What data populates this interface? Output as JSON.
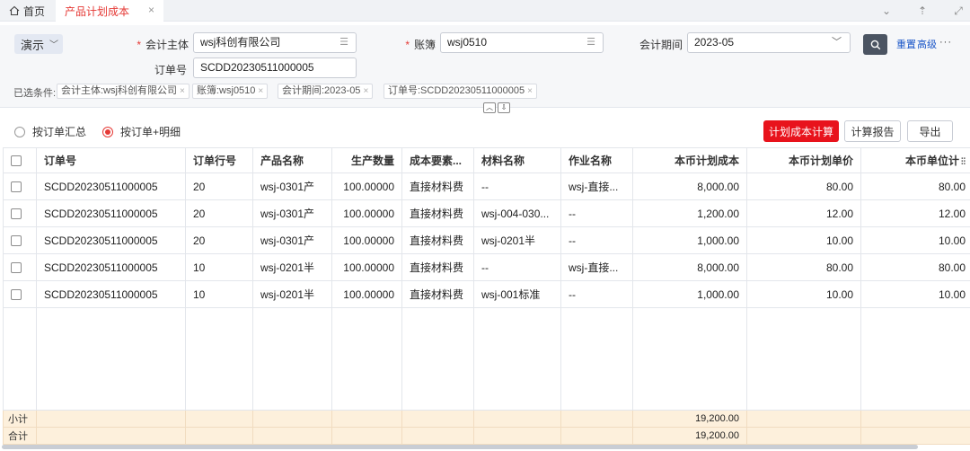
{
  "tabs": {
    "home_label": "首页",
    "active_label": "产品计划成本"
  },
  "scheme": {
    "label": "演示"
  },
  "filters": {
    "company": {
      "label": "会计主体",
      "value": "wsj科创有限公司"
    },
    "ledger": {
      "label": "账簿",
      "value": "wsj0510"
    },
    "period": {
      "label": "会计期间",
      "value": "2023-05"
    },
    "order": {
      "label": "订单号",
      "value": "SCDD20230511000005"
    },
    "reset_label": "重置",
    "advanced_label": "高级",
    "more_label": "···"
  },
  "selected": {
    "label": "已选条件:",
    "chips": [
      "会计主体:wsj科创有限公司",
      "账簿:wsj0510",
      "会计期间:2023-05",
      "订单号:SCDD20230511000005"
    ]
  },
  "toolbar": {
    "radio_summary": "按订单汇总",
    "radio_detail": "按订单+明细",
    "selected_mode": "按订单+明细",
    "calc_label": "计划成本计算",
    "report_label": "计算报告",
    "export_label": "导出"
  },
  "table": {
    "headers": [
      "订单号",
      "订单行号",
      "产品名称",
      "生产数量",
      "成本要素...",
      "材料名称",
      "作业名称",
      "本币计划成本",
      "本币计划单价",
      "本币单位计"
    ],
    "rows": [
      [
        "SCDD20230511000005",
        "20",
        "wsj-0301产",
        "100.00000",
        "直接材料费",
        "--",
        "wsj-直接...",
        "8,000.00",
        "80.00",
        "80.00"
      ],
      [
        "SCDD20230511000005",
        "20",
        "wsj-0301产",
        "100.00000",
        "直接材料费",
        "wsj-004-030...",
        "--",
        "1,200.00",
        "12.00",
        "12.00"
      ],
      [
        "SCDD20230511000005",
        "20",
        "wsj-0301产",
        "100.00000",
        "直接材料费",
        "wsj-0201半",
        "--",
        "1,000.00",
        "10.00",
        "10.00"
      ],
      [
        "SCDD20230511000005",
        "10",
        "wsj-0201半",
        "100.00000",
        "直接材料费",
        "--",
        "wsj-直接...",
        "8,000.00",
        "80.00",
        "80.00"
      ],
      [
        "SCDD20230511000005",
        "10",
        "wsj-0201半",
        "100.00000",
        "直接材料费",
        "wsj-001标准",
        "--",
        "1,000.00",
        "10.00",
        "10.00"
      ]
    ],
    "subtotal_label": "小计",
    "subtotal_value": "19,200.00",
    "total_label": "合计",
    "total_value": "19,200.00"
  },
  "colors": {
    "accent": "#e8131c",
    "link": "#1a56c8",
    "summary_bg": "#fdf0dc"
  }
}
